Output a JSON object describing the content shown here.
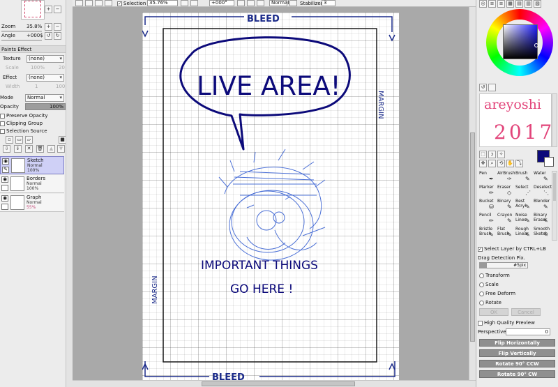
{
  "left": {
    "zoom_label": "Zoom",
    "zoom_value": "35.8%",
    "angle_label": "Angle",
    "angle_value": "+000$",
    "paints_effect": "Paints Effect",
    "texture_label": "Texture",
    "texture_value": "(none)",
    "scale_label": "Scale",
    "scale_value": "100%",
    "scale_num": "20",
    "effect_label": "Effect",
    "effect_value": "(none)",
    "width_label": "Width",
    "width_value": "1",
    "width_num": "100",
    "mode_label": "Mode",
    "mode_value": "Normal",
    "opacity_label": "Opacity",
    "opacity_value": "100%",
    "preserve_opacity": "Preserve Opacity",
    "clipping_group": "Clipping Group",
    "selection_source": "Selection Source",
    "layers": [
      {
        "name": "Sketch",
        "mode": "Normal",
        "opacity": "100%"
      },
      {
        "name": "Borders",
        "mode": "Normal",
        "opacity": "100%"
      },
      {
        "name": "Graph",
        "mode": "Normal",
        "opacity": "55%"
      }
    ]
  },
  "topbar": {
    "selection_label": "Selection",
    "zoom_value": "35.76%",
    "angle_value": "+000°",
    "blend_mode": "Normal",
    "stabilizer_label": "Stabilizer",
    "stabilizer_value": "3"
  },
  "canvas": {
    "bleed_top": "BLEED",
    "bleed_bottom": "BLEED",
    "margin_left": "MARGIN",
    "margin_right": "MARGIN",
    "bubble_text": "LIVE AREA!",
    "note_line1": "IMPORTANT THINGS",
    "note_line2": "GO HERE !"
  },
  "right": {
    "signature_line1": "areyoshi",
    "signature_line2": "2017",
    "primary_color": "#0c0a7a",
    "tools": [
      {
        "label1": "Pen",
        "label2": "",
        "icon": "pen-icon"
      },
      {
        "label1": "AirBrush",
        "label2": "",
        "icon": "airbrush-icon"
      },
      {
        "label1": "Brush",
        "label2": "",
        "icon": "brush-icon"
      },
      {
        "label1": "Water",
        "label2": "",
        "icon": "water-icon"
      },
      {
        "label1": "Marker",
        "label2": "",
        "icon": "marker-icon"
      },
      {
        "label1": "Eraser",
        "label2": "",
        "icon": "eraser-icon"
      },
      {
        "label1": "Select",
        "label2": "",
        "icon": "select-icon"
      },
      {
        "label1": "Deselect",
        "label2": "",
        "icon": "deselect-icon"
      },
      {
        "label1": "Bucket",
        "label2": "",
        "icon": "bucket-icon"
      },
      {
        "label1": "Binary",
        "label2": "",
        "icon": "binary-icon"
      },
      {
        "label1": "Best",
        "label2": "Acryl",
        "icon": "acrylic-icon"
      },
      {
        "label1": "Blender",
        "label2": "",
        "icon": "blender-icon"
      },
      {
        "label1": "Pencil",
        "label2": "",
        "icon": "pencil-icon"
      },
      {
        "label1": "Crayon",
        "label2": "",
        "icon": "crayon-icon"
      },
      {
        "label1": "Noise",
        "label2": "Lines",
        "icon": "noise-lines-icon"
      },
      {
        "label1": "Binary",
        "label2": "Eraser",
        "icon": "binary-eraser-icon"
      },
      {
        "label1": "Bristle",
        "label2": "Brush",
        "icon": "bristle-brush-icon"
      },
      {
        "label1": "Flat",
        "label2": "Brush",
        "icon": "flat-brush-icon"
      },
      {
        "label1": "Rough",
        "label2": "Linear",
        "icon": "rough-linear-icon"
      },
      {
        "label1": "Smooth",
        "label2": "Sketch",
        "icon": "smooth-sketch-icon"
      }
    ],
    "select_layer": "Select Layer by CTRL+LB",
    "drag_detection": "Drag Detection Pix.",
    "drag_value": "#5pix",
    "transform_options": [
      "Transform",
      "Scale",
      "Free Deform",
      "Rotate"
    ],
    "ok_label": "OK",
    "cancel_label": "Cancel",
    "high_quality_preview": "High Quality Preview",
    "perspective_label": "Perspective",
    "perspective_value": "0",
    "flip_horizontally": "Flip Horizontally",
    "flip_vertically": "Flip Vertically",
    "rotate_ccw": "Rotate 90° CCW",
    "rotate_cw": "Rotate 90° CW"
  }
}
